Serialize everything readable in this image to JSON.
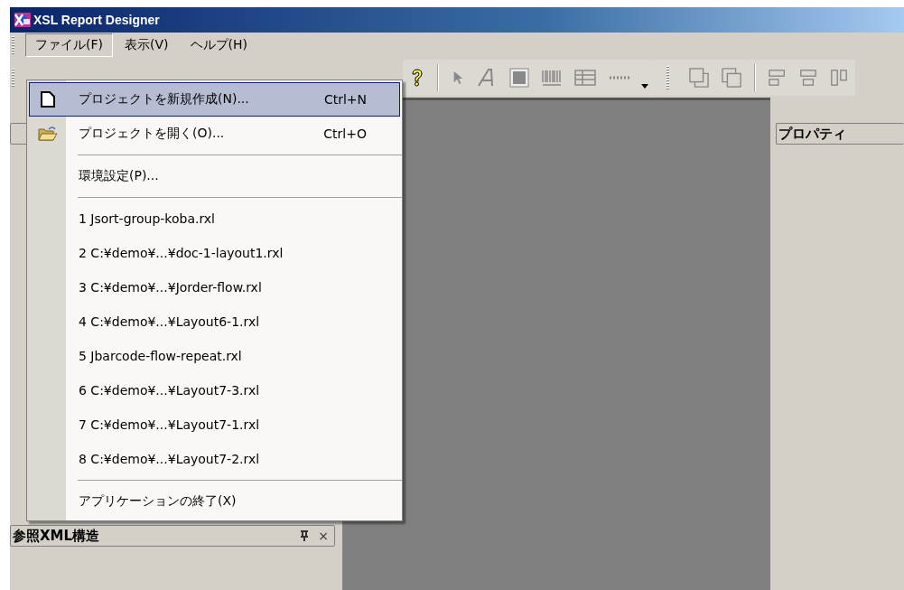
{
  "window": {
    "title": "XSL Report Designer"
  },
  "menu_bar": [
    {
      "label": "ファイル(F)",
      "selected": true
    },
    {
      "label": "表示(V)",
      "selected": false
    },
    {
      "label": "ヘルプ(H)",
      "selected": false
    }
  ],
  "file_menu": [
    {
      "kind": "new",
      "label": "プロジェクトを新規作成(N)...",
      "shortcut": "Ctrl+N",
      "selected": true
    },
    {
      "kind": "open",
      "label": "プロジェクトを開く(O)...",
      "shortcut": "Ctrl+O",
      "selected": false
    },
    {
      "kind": "separator"
    },
    {
      "kind": "command",
      "label": "環境設定(P)...",
      "selected": false
    },
    {
      "kind": "separator"
    },
    {
      "kind": "command",
      "label": "1 Jsort-group-koba.rxl",
      "selected": false
    },
    {
      "kind": "command",
      "label": "2 C:¥demo¥...¥doc-1-layout1.rxl",
      "selected": false
    },
    {
      "kind": "command",
      "label": "3 C:¥demo¥...¥Jorder-flow.rxl",
      "selected": false
    },
    {
      "kind": "command",
      "label": "4 C:¥demo¥...¥Layout6-1.rxl",
      "selected": false
    },
    {
      "kind": "command",
      "label": "5 Jbarcode-flow-repeat.rxl",
      "selected": false
    },
    {
      "kind": "command",
      "label": "6 C:¥demo¥...¥Layout7-3.rxl",
      "selected": false
    },
    {
      "kind": "command",
      "label": "7 C:¥demo¥...¥Layout7-1.rxl",
      "selected": false
    },
    {
      "kind": "command",
      "label": "8 C:¥demo¥...¥Layout7-2.rxl",
      "selected": false
    },
    {
      "kind": "separator"
    },
    {
      "kind": "command",
      "label": "アプリケーションの終了(X)",
      "selected": false
    }
  ],
  "left_panel": {
    "title": "参照XML構造",
    "close": "×"
  },
  "properties_panel": {
    "title": "プロパティ"
  }
}
